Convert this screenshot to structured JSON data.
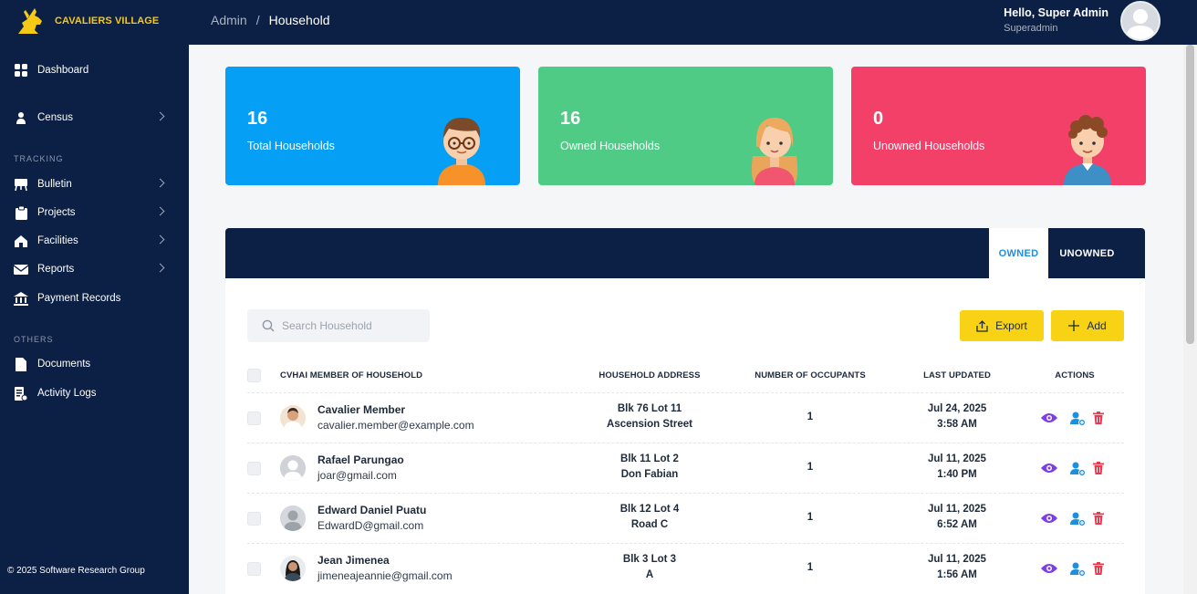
{
  "brand": {
    "name": "CAVALIERS VILLAGE",
    "accent": "#f5c915",
    "navy": "#0c1f44"
  },
  "sidebar": {
    "items": [
      {
        "label": "Dashboard",
        "icon": "dashboard-grid-icon"
      },
      {
        "label": "Census",
        "icon": "person-icon"
      },
      {
        "label": "Bulletin",
        "icon": "easel-icon"
      },
      {
        "label": "Projects",
        "icon": "clipboard-icon"
      },
      {
        "label": "Facilities",
        "icon": "building-icon"
      },
      {
        "label": "Reports",
        "icon": "envelope-icon"
      },
      {
        "label": "Payment Records",
        "icon": "bank-icon"
      },
      {
        "label": "Documents",
        "icon": "document-icon"
      },
      {
        "label": "Activity Logs",
        "icon": "log-icon"
      }
    ],
    "sections": {
      "tracking": "TRACKING",
      "others": "OTHERS"
    },
    "footer": "© 2025 Software Research Group"
  },
  "header": {
    "breadcrumb": {
      "root": "Admin",
      "separator": "/",
      "current": "Household"
    },
    "greeting": "Hello, Super Admin",
    "role": "Superadmin"
  },
  "stats": [
    {
      "value": "16",
      "label": "Total Households",
      "color": "#059ff5"
    },
    {
      "value": "16",
      "label": "Owned Households",
      "color": "#4fcb86"
    },
    {
      "value": "0",
      "label": "Unowned Households",
      "color": "#f24069"
    }
  ],
  "tabs": {
    "owned": "OWNED",
    "unowned": "UNOWNED"
  },
  "search": {
    "placeholder": "Search Household",
    "value": ""
  },
  "buttons": {
    "export": "Export",
    "add": "Add"
  },
  "table": {
    "headers": {
      "member": "CVHAI MEMBER OF HOUSEHOLD",
      "address": "HOUSEHOLD ADDRESS",
      "occupants": "NUMBER OF OCCUPANTS",
      "updated": "LAST UPDATED",
      "actions": "ACTIONS"
    },
    "rows": [
      {
        "name": "Cavalier Member",
        "email": "cavalier.member@example.com",
        "addr1": "Blk 76 Lot 11",
        "addr2": "Ascension Street",
        "occupants": "1",
        "date": "Jul 24, 2025",
        "time": "3:58 AM"
      },
      {
        "name": "Rafael Parungao",
        "email": "joar@gmail.com",
        "addr1": "Blk 11 Lot 2",
        "addr2": "Don Fabian",
        "occupants": "1",
        "date": "Jul 11, 2025",
        "time": "1:40 PM"
      },
      {
        "name": "Edward Daniel Puatu",
        "email": "EdwardD@gmail.com",
        "addr1": "Blk 12 Lot 4",
        "addr2": "Road C",
        "occupants": "1",
        "date": "Jul 11, 2025",
        "time": "6:52 AM"
      },
      {
        "name": "Jean Jimenea",
        "email": "jimeneajeannie@gmail.com",
        "addr1": "Blk 3 Lot 3",
        "addr2": "A",
        "occupants": "1",
        "date": "Jul 11, 2025",
        "time": "1:56 AM"
      }
    ]
  },
  "colors": {
    "action_view": "#7b3fe4",
    "action_assign": "#1d8fe0",
    "action_delete": "#e8394f",
    "button_yellow": "#f8d315"
  }
}
